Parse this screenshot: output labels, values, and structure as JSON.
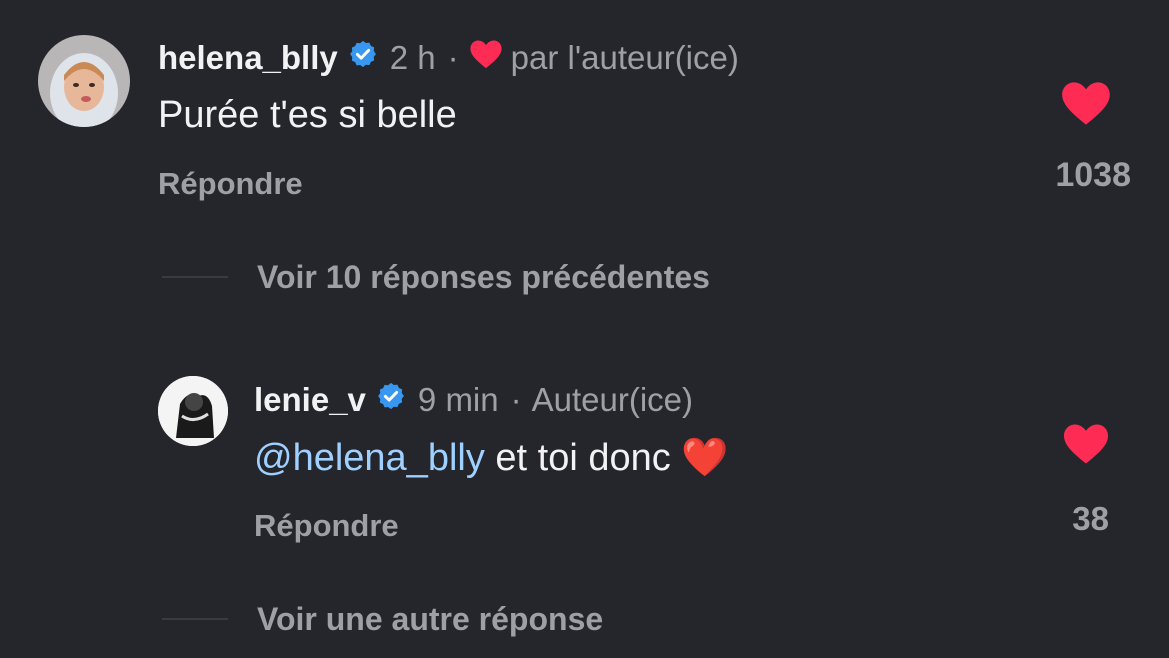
{
  "comments": [
    {
      "username": "helena_blly",
      "time": "2 h",
      "separator": "·",
      "liked_by_author_label": "par l'auteur(ice)",
      "text": "Purée t'es si belle",
      "reply_label": "Répondre",
      "like_count": "1038"
    },
    {
      "username": "lenie_v",
      "time": "9 min",
      "separator": "·",
      "author_label": "Auteur(ice)",
      "mention": "@helena_blly",
      "text_after_mention": " et toi donc ",
      "emoji": "❤️",
      "reply_label": "Répondre",
      "like_count": "38"
    }
  ],
  "view_previous_replies": "Voir 10 réponses précédentes",
  "view_another_reply": "Voir une autre réponse",
  "colors": {
    "background": "#25262b",
    "heart": "#fe2c55",
    "verified": "#20d5ec",
    "muted_text": "#9ea0a6",
    "mention": "#9fd0ff"
  },
  "icons": [
    "verified-badge-icon",
    "heart-icon"
  ]
}
